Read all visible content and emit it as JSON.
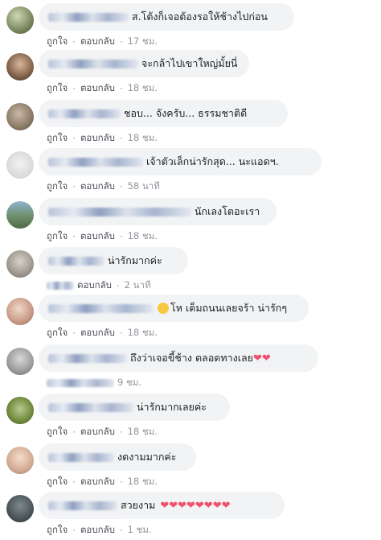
{
  "comments": [
    {
      "text": "ส.โต้งก็เจอต้องรอให้ช้างไปก่อน",
      "like": "ถูกใจ",
      "reply": "ตอบกลับ",
      "time": "17 ชม.",
      "hearts": ""
    },
    {
      "text": "จะกล้าไปเขาใหญ่มั้ยนี่",
      "like": "ถูกใจ",
      "reply": "ตอบกลับ",
      "time": "18 ชม.",
      "hearts": ""
    },
    {
      "text": "ชอบ... จังครับ... ธรรมชาติดี",
      "like": "ถูกใจ",
      "reply": "ตอบกลับ",
      "time": "18 ชม.",
      "hearts": ""
    },
    {
      "text": "เจ้าตัวเล็กน่ารักสุด... นะแอดฯ.",
      "like": "ถูกใจ",
      "reply": "ตอบกลับ",
      "time": "58 นาที",
      "hearts": ""
    },
    {
      "text": "นักเลงโตอะเรา",
      "like": "ถูกใจ",
      "reply": "ตอบกลับ",
      "time": "18 ชม.",
      "hearts": ""
    },
    {
      "text": "น่ารักมากค่ะ",
      "like": "",
      "reply": "ตอบกลับ",
      "time": "2 นาที",
      "hearts": ""
    },
    {
      "text": "โห เต็มถนนเลยจร้า น่ารักๆ",
      "like": "ถูกใจ",
      "reply": "ตอบกลับ",
      "time": "18 ชม.",
      "hearts": ""
    },
    {
      "text": "ถึงว่าเจอขี้ช้าง ตลอดทางเลย",
      "like": "",
      "reply": "ตอบกลับ",
      "time": "9 ชม.",
      "hearts": "❤❤"
    },
    {
      "text": "น่ารักมากเลยค่ะ",
      "like": "ถูกใจ",
      "reply": "ตอบกลับ",
      "time": "18 ชม.",
      "hearts": ""
    },
    {
      "text": "งดงามมากค่ะ",
      "like": "ถูกใจ",
      "reply": "ตอบกลับ",
      "time": "18 ชม.",
      "hearts": ""
    },
    {
      "text": "สวยงาม",
      "like": "ถูกใจ",
      "reply": "ตอบกลับ",
      "time": "1 ชม.",
      "hearts": "❤❤❤❤❤❤❤❤"
    }
  ],
  "colors": {
    "bubble": "#f2f3f5",
    "link": "#4b4f56",
    "meta": "#90949c",
    "heart": "#f0506e"
  }
}
